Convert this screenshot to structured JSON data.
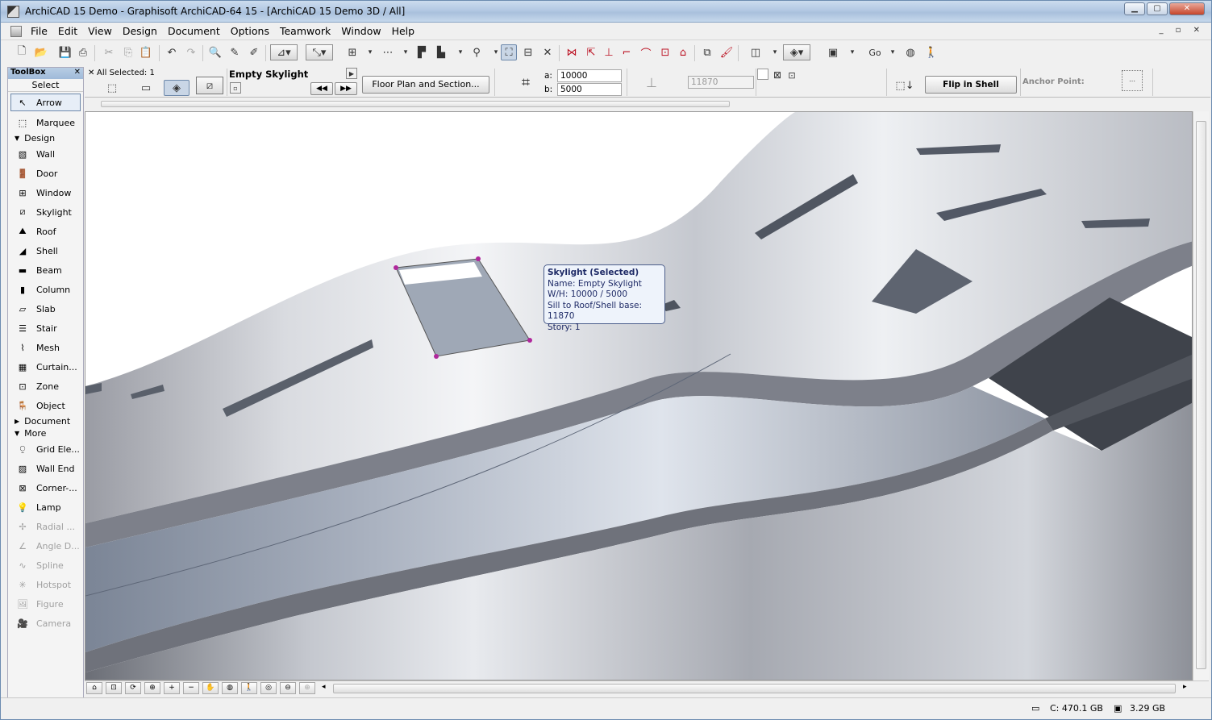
{
  "window": {
    "title": "ArchiCAD 15 Demo - Graphisoft ArchiCAD-64 15 - [ArchiCAD 15 Demo 3D / All]"
  },
  "menu": [
    "File",
    "Edit",
    "View",
    "Design",
    "Document",
    "Options",
    "Teamwork",
    "Window",
    "Help"
  ],
  "toolbar": {
    "go_label": "Go"
  },
  "toolbox": {
    "title": "ToolBox",
    "select_label": "Select",
    "arrow": "Arrow",
    "marquee": "Marquee",
    "design_section": "Design",
    "design_tools": [
      "Wall",
      "Door",
      "Window",
      "Skylight",
      "Roof",
      "Shell",
      "Beam",
      "Column",
      "Slab",
      "Stair",
      "Mesh",
      "Curtain...",
      "Zone",
      "Object"
    ],
    "document_section": "Document",
    "more_section": "More",
    "more_tools": [
      "Grid Ele...",
      "Wall End",
      "Corner-...",
      "Lamp"
    ],
    "disabled_tools": [
      "Radial ...",
      "Angle D...",
      "Spline",
      "Hotspot",
      "Figure",
      "Camera"
    ]
  },
  "infobox": {
    "selected": "All Selected: 1",
    "name": "Empty Skylight",
    "view_button": "Floor Plan and Section...",
    "a_label": "a:",
    "a_value": "10000",
    "b_label": "b:",
    "b_value": "5000",
    "sill_value": "11870",
    "flip_button": "Flip in Shell",
    "anchor_label": "Anchor Point:"
  },
  "tooltip": {
    "title": "Skylight (Selected)",
    "name": "Name: Empty Skylight",
    "wh": "W/H: 10000 / 5000",
    "sill": "Sill to Roof/Shell base: 11870",
    "story": "Story: 1"
  },
  "status": {
    "disk": "C: 470.1 GB",
    "memory": "3.29 GB"
  }
}
